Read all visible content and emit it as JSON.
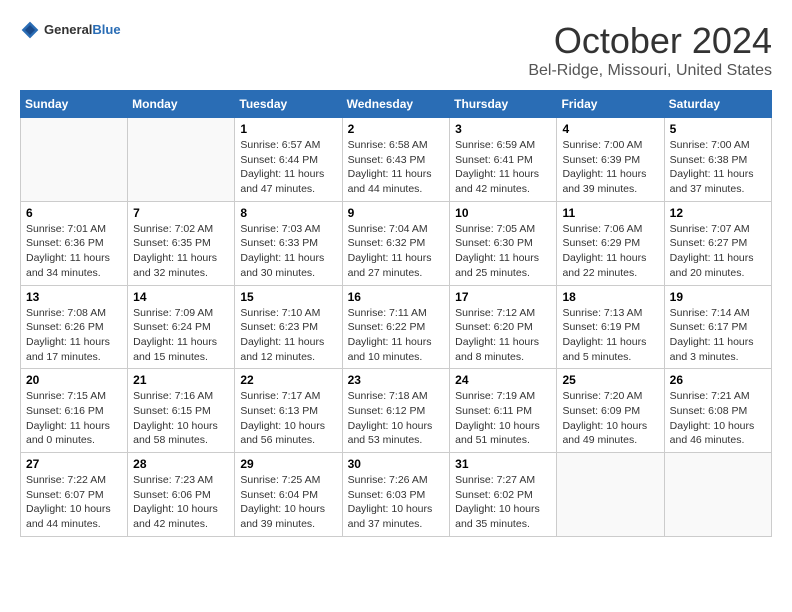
{
  "header": {
    "logo_general": "General",
    "logo_blue": "Blue",
    "title": "October 2024",
    "subtitle": "Bel-Ridge, Missouri, United States"
  },
  "weekdays": [
    "Sunday",
    "Monday",
    "Tuesday",
    "Wednesday",
    "Thursday",
    "Friday",
    "Saturday"
  ],
  "weeks": [
    [
      {
        "day": "",
        "info": ""
      },
      {
        "day": "",
        "info": ""
      },
      {
        "day": "1",
        "sunrise": "Sunrise: 6:57 AM",
        "sunset": "Sunset: 6:44 PM",
        "daylight": "Daylight: 11 hours and 47 minutes."
      },
      {
        "day": "2",
        "sunrise": "Sunrise: 6:58 AM",
        "sunset": "Sunset: 6:43 PM",
        "daylight": "Daylight: 11 hours and 44 minutes."
      },
      {
        "day": "3",
        "sunrise": "Sunrise: 6:59 AM",
        "sunset": "Sunset: 6:41 PM",
        "daylight": "Daylight: 11 hours and 42 minutes."
      },
      {
        "day": "4",
        "sunrise": "Sunrise: 7:00 AM",
        "sunset": "Sunset: 6:39 PM",
        "daylight": "Daylight: 11 hours and 39 minutes."
      },
      {
        "day": "5",
        "sunrise": "Sunrise: 7:00 AM",
        "sunset": "Sunset: 6:38 PM",
        "daylight": "Daylight: 11 hours and 37 minutes."
      }
    ],
    [
      {
        "day": "6",
        "sunrise": "Sunrise: 7:01 AM",
        "sunset": "Sunset: 6:36 PM",
        "daylight": "Daylight: 11 hours and 34 minutes."
      },
      {
        "day": "7",
        "sunrise": "Sunrise: 7:02 AM",
        "sunset": "Sunset: 6:35 PM",
        "daylight": "Daylight: 11 hours and 32 minutes."
      },
      {
        "day": "8",
        "sunrise": "Sunrise: 7:03 AM",
        "sunset": "Sunset: 6:33 PM",
        "daylight": "Daylight: 11 hours and 30 minutes."
      },
      {
        "day": "9",
        "sunrise": "Sunrise: 7:04 AM",
        "sunset": "Sunset: 6:32 PM",
        "daylight": "Daylight: 11 hours and 27 minutes."
      },
      {
        "day": "10",
        "sunrise": "Sunrise: 7:05 AM",
        "sunset": "Sunset: 6:30 PM",
        "daylight": "Daylight: 11 hours and 25 minutes."
      },
      {
        "day": "11",
        "sunrise": "Sunrise: 7:06 AM",
        "sunset": "Sunset: 6:29 PM",
        "daylight": "Daylight: 11 hours and 22 minutes."
      },
      {
        "day": "12",
        "sunrise": "Sunrise: 7:07 AM",
        "sunset": "Sunset: 6:27 PM",
        "daylight": "Daylight: 11 hours and 20 minutes."
      }
    ],
    [
      {
        "day": "13",
        "sunrise": "Sunrise: 7:08 AM",
        "sunset": "Sunset: 6:26 PM",
        "daylight": "Daylight: 11 hours and 17 minutes."
      },
      {
        "day": "14",
        "sunrise": "Sunrise: 7:09 AM",
        "sunset": "Sunset: 6:24 PM",
        "daylight": "Daylight: 11 hours and 15 minutes."
      },
      {
        "day": "15",
        "sunrise": "Sunrise: 7:10 AM",
        "sunset": "Sunset: 6:23 PM",
        "daylight": "Daylight: 11 hours and 12 minutes."
      },
      {
        "day": "16",
        "sunrise": "Sunrise: 7:11 AM",
        "sunset": "Sunset: 6:22 PM",
        "daylight": "Daylight: 11 hours and 10 minutes."
      },
      {
        "day": "17",
        "sunrise": "Sunrise: 7:12 AM",
        "sunset": "Sunset: 6:20 PM",
        "daylight": "Daylight: 11 hours and 8 minutes."
      },
      {
        "day": "18",
        "sunrise": "Sunrise: 7:13 AM",
        "sunset": "Sunset: 6:19 PM",
        "daylight": "Daylight: 11 hours and 5 minutes."
      },
      {
        "day": "19",
        "sunrise": "Sunrise: 7:14 AM",
        "sunset": "Sunset: 6:17 PM",
        "daylight": "Daylight: 11 hours and 3 minutes."
      }
    ],
    [
      {
        "day": "20",
        "sunrise": "Sunrise: 7:15 AM",
        "sunset": "Sunset: 6:16 PM",
        "daylight": "Daylight: 11 hours and 0 minutes."
      },
      {
        "day": "21",
        "sunrise": "Sunrise: 7:16 AM",
        "sunset": "Sunset: 6:15 PM",
        "daylight": "Daylight: 10 hours and 58 minutes."
      },
      {
        "day": "22",
        "sunrise": "Sunrise: 7:17 AM",
        "sunset": "Sunset: 6:13 PM",
        "daylight": "Daylight: 10 hours and 56 minutes."
      },
      {
        "day": "23",
        "sunrise": "Sunrise: 7:18 AM",
        "sunset": "Sunset: 6:12 PM",
        "daylight": "Daylight: 10 hours and 53 minutes."
      },
      {
        "day": "24",
        "sunrise": "Sunrise: 7:19 AM",
        "sunset": "Sunset: 6:11 PM",
        "daylight": "Daylight: 10 hours and 51 minutes."
      },
      {
        "day": "25",
        "sunrise": "Sunrise: 7:20 AM",
        "sunset": "Sunset: 6:09 PM",
        "daylight": "Daylight: 10 hours and 49 minutes."
      },
      {
        "day": "26",
        "sunrise": "Sunrise: 7:21 AM",
        "sunset": "Sunset: 6:08 PM",
        "daylight": "Daylight: 10 hours and 46 minutes."
      }
    ],
    [
      {
        "day": "27",
        "sunrise": "Sunrise: 7:22 AM",
        "sunset": "Sunset: 6:07 PM",
        "daylight": "Daylight: 10 hours and 44 minutes."
      },
      {
        "day": "28",
        "sunrise": "Sunrise: 7:23 AM",
        "sunset": "Sunset: 6:06 PM",
        "daylight": "Daylight: 10 hours and 42 minutes."
      },
      {
        "day": "29",
        "sunrise": "Sunrise: 7:25 AM",
        "sunset": "Sunset: 6:04 PM",
        "daylight": "Daylight: 10 hours and 39 minutes."
      },
      {
        "day": "30",
        "sunrise": "Sunrise: 7:26 AM",
        "sunset": "Sunset: 6:03 PM",
        "daylight": "Daylight: 10 hours and 37 minutes."
      },
      {
        "day": "31",
        "sunrise": "Sunrise: 7:27 AM",
        "sunset": "Sunset: 6:02 PM",
        "daylight": "Daylight: 10 hours and 35 minutes."
      },
      {
        "day": "",
        "info": ""
      },
      {
        "day": "",
        "info": ""
      }
    ]
  ]
}
